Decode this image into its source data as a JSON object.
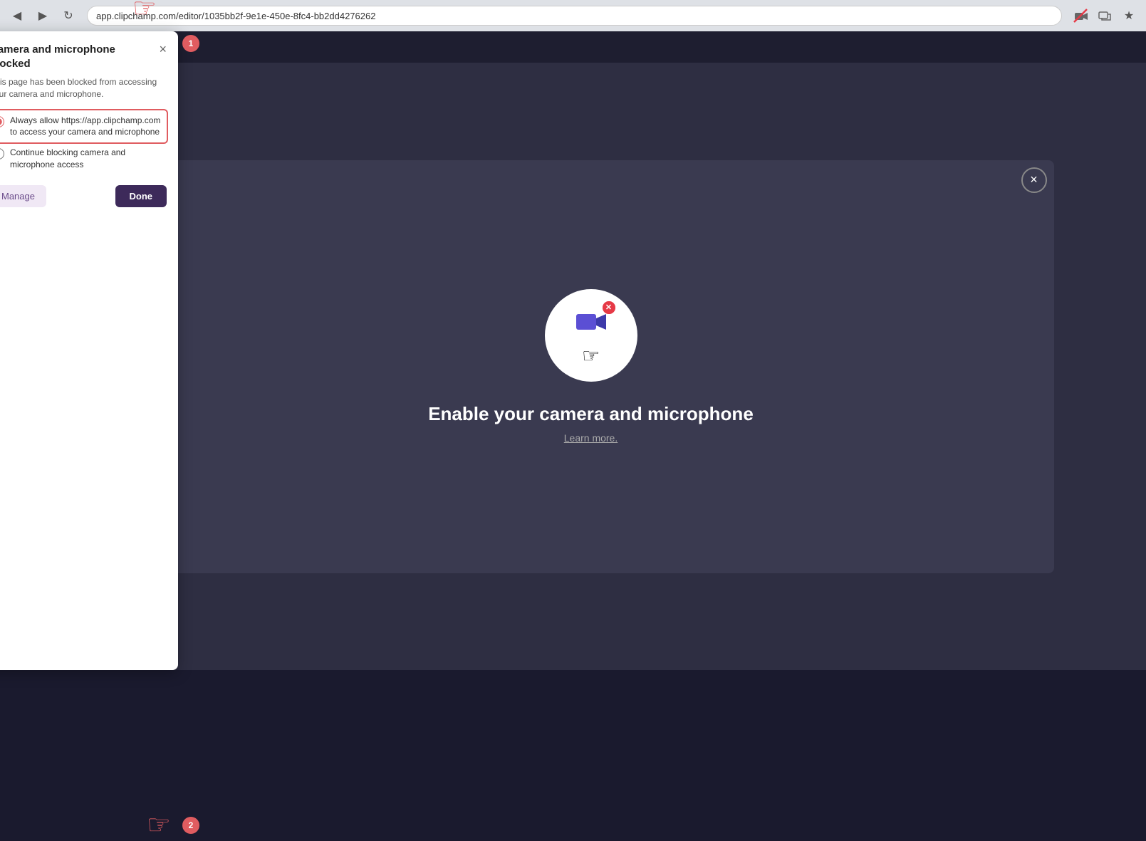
{
  "browser": {
    "url": "app.clipchamp.com/editor/1035bb2f-9e1e-450e-8fc4-bb2dd4276262",
    "back_icon": "◀",
    "forward_icon": "▶",
    "refresh_icon": "↻"
  },
  "popup": {
    "title": "Camera and microphone blocked",
    "description": "This page has been blocked from accessing your camera and microphone.",
    "option1_label": "Always allow https://app.clipchamp.com to access your camera and microphone",
    "option2_label": "Continue blocking camera and microphone access",
    "manage_label": "Manage",
    "done_label": "Done",
    "close_label": "×",
    "annotation1": "1",
    "annotation2": "2"
  },
  "main_panel": {
    "title": "Enable your camera and microphone",
    "learn_more": "Learn more.",
    "close_label": "×"
  }
}
